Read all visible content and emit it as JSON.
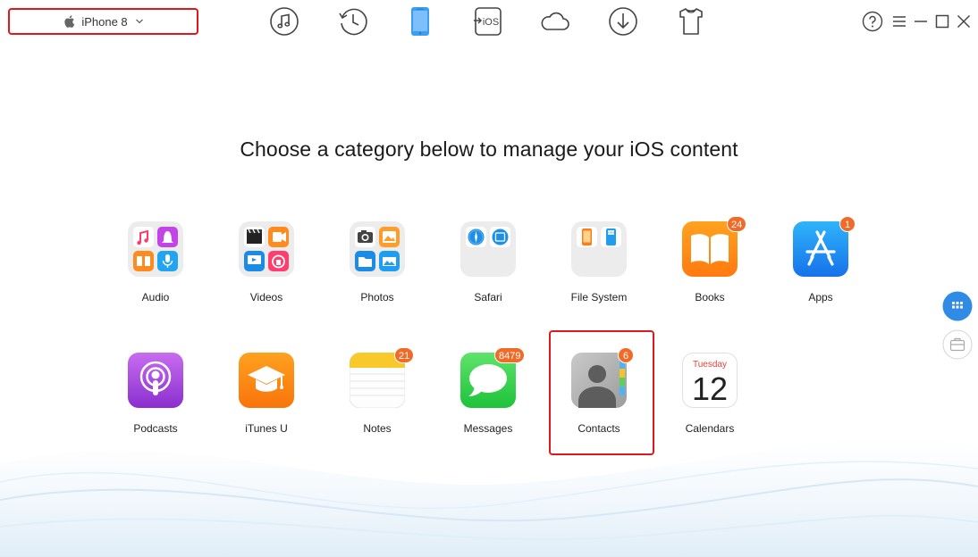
{
  "topbar": {
    "device_name": "iPhone 8",
    "nav_icons": [
      "music-icon",
      "history-icon",
      "phone-icon",
      "ios-transfer-icon",
      "cloud-icon",
      "download-icon",
      "tshirt-icon"
    ],
    "ios_label": "iOS",
    "window_controls": [
      "help-icon",
      "menu-icon",
      "minimize-icon",
      "maximize-icon",
      "close-icon"
    ]
  },
  "headline": "Choose a category below to manage your iOS content",
  "categories": [
    {
      "label": "Audio",
      "badge": ""
    },
    {
      "label": "Videos",
      "badge": ""
    },
    {
      "label": "Photos",
      "badge": ""
    },
    {
      "label": "Safari",
      "badge": ""
    },
    {
      "label": "File System",
      "badge": ""
    },
    {
      "label": "Books",
      "badge": "24"
    },
    {
      "label": "Apps",
      "badge": "1"
    },
    {
      "label": "Podcasts",
      "badge": ""
    },
    {
      "label": "iTunes U",
      "badge": ""
    },
    {
      "label": "Notes",
      "badge": "21"
    },
    {
      "label": "Messages",
      "badge": "8479"
    },
    {
      "label": "Contacts",
      "badge": "6"
    },
    {
      "label": "Calendars",
      "badge": ""
    }
  ],
  "calendar": {
    "weekday": "Tuesday",
    "day": "12"
  },
  "side_buttons": [
    "grid-view-icon",
    "toolbox-icon"
  ],
  "colors": {
    "highlight": "#e0171b",
    "badge": "#f06a28",
    "accent": "#2f8be6"
  }
}
